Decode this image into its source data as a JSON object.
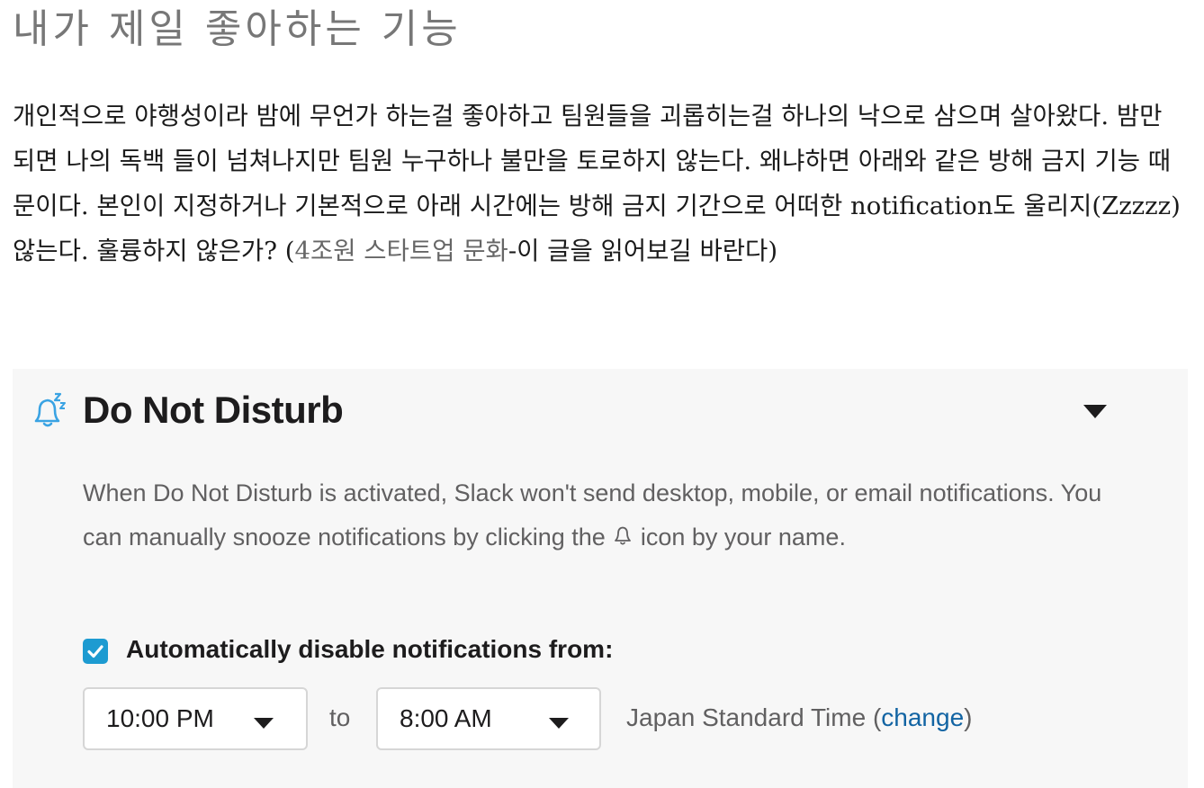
{
  "article": {
    "heading": "내가 제일 좋아하는 기능",
    "paragraph": "개인적으로 야행성이라 밤에 무언가 하는걸 좋아하고 팀원들을 괴롭히는걸 하나의 낙으로 삼으며 살아왔다. 밤만 되면 나의 독백 들이 넘쳐나지만 팀원 누구하나 불만을 토로하지 않는다. 왜냐하면 아래와 같은 방해 금지 기능 때문이다. 본인이 지정하거나 기본적으로 아래 시간에는 방해 금지 기간으로 어떠한 notification도 울리지(Zzzzz) 않는다. 훌륭하지 않은가?",
    "link_open": " (",
    "link_text": "4조원 스타트업 문화",
    "link_after": "-이 글을 읽어보길 바란다)"
  },
  "dnd": {
    "icon": "bell-snooze-icon",
    "title": "Do Not Disturb",
    "collapse_icon": "caret-down-icon",
    "description_before": "When Do Not Disturb is activated, Slack won't send desktop, mobile, or email notifications. You can manually snooze notifications by clicking the ",
    "description_icon": "bell-icon",
    "description_after": " icon by your name.",
    "checkbox_checked": true,
    "checkbox_label": "Automatically disable notifications from:",
    "from_time": "10:00 PM",
    "to_label": "to",
    "to_time": "8:00 AM",
    "timezone": "Japan Standard Time",
    "tz_open": " (",
    "change_link": "change",
    "tz_close": ")"
  },
  "colors": {
    "accent_checkbox": "#1d9bd1",
    "link_blue": "#1264a3",
    "icon_blue": "#3aa3e3",
    "heading_gray": "#777777"
  }
}
